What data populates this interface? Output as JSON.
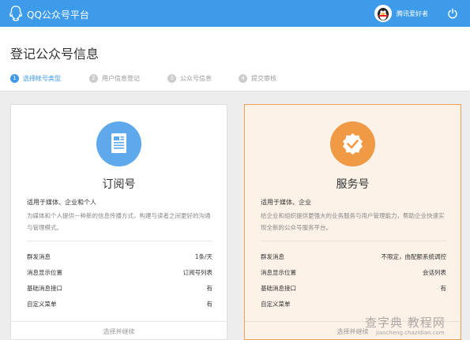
{
  "header": {
    "app_title": "QQ公众号平台",
    "username": "腾讯爱好者",
    "brand_color": "#3d9be9"
  },
  "page": {
    "title": "登记公众号信息"
  },
  "steps": [
    {
      "num": "1",
      "label": "选择帐号类型",
      "active": true
    },
    {
      "num": "2",
      "label": "用户信息登记",
      "active": false
    },
    {
      "num": "3",
      "label": "公众号信息",
      "active": false
    },
    {
      "num": "4",
      "label": "提交审核",
      "active": false
    }
  ],
  "cards": {
    "subscription": {
      "icon": "document-icon",
      "title": "订阅号",
      "subtitle": "适用于媒体、企业和个人",
      "desc": "为媒体和个人提供一种新的信息传播方式，构建与读者之间更好的沟通与管理模式。",
      "features": [
        {
          "name": "群发消息",
          "value": "1条/天"
        },
        {
          "name": "消息显示位置",
          "value": "订阅号列表"
        },
        {
          "name": "基础消息接口",
          "value": "有"
        },
        {
          "name": "自定义菜单",
          "value": "有"
        }
      ],
      "footer": "选择并继续",
      "accent": "#5ea8ec"
    },
    "service": {
      "icon": "badge-check-icon",
      "title": "服务号",
      "subtitle": "适用于媒体、企业",
      "desc": "给企业和组织提供更强大的业务服务与用户管理能力，帮助企业快速实现全新的公众号服务平台。",
      "features": [
        {
          "name": "群发消息",
          "value": "不限定，由配额系统调控"
        },
        {
          "name": "消息显示位置",
          "value": "会话列表"
        },
        {
          "name": "基础消息接口",
          "value": "有"
        },
        {
          "name": "自定义菜单",
          "value": ""
        }
      ],
      "footer": "选择并继续",
      "accent": "#f09a45"
    }
  },
  "watermark": {
    "main": "查字典 教程网",
    "url": "jiaocheng.chazidian.com"
  }
}
